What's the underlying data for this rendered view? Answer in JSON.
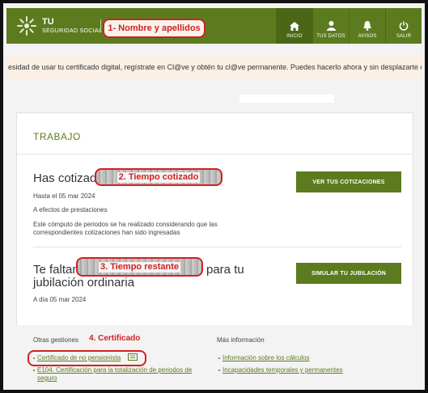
{
  "header": {
    "logo_line1": "TU",
    "logo_line2": "SEGURIDAD SOCIAL",
    "nav": [
      {
        "label": "INICIO",
        "icon": "home-icon"
      },
      {
        "label": "TUS DATOS",
        "icon": "user-icon"
      },
      {
        "label": "AVISOS",
        "icon": "bell-icon"
      },
      {
        "label": "SALIR",
        "icon": "power-icon"
      }
    ]
  },
  "annotations": {
    "name": "1- Nombre y apellidos",
    "time": "2. Tiempo cotizado",
    "remaining": "3. Tiempo restante",
    "certificate": "4. Certificado"
  },
  "banner": {
    "text": "esidad de usar tu certificado digital, regístrate en Cl@ve y obtén tu cl@ve permanente. Puedes hacerlo ahora y sin desplazarte desde aquí"
  },
  "trabajo": {
    "title": "TRABAJO",
    "cotizado_label": "Has cotizado",
    "cotizado_date": "Hasta el 05 mar 2024",
    "cotizado_note": "A efectos de prestaciones",
    "cotizado_desc": "Este cómputo de periodos se ha realizado considerando que las correspondientes cotizaciones han sido ingresadas",
    "cotizaciones_button": "VER TUS COTIZACIONES",
    "faltan_prefix": "Te faltan",
    "faltan_suffix": "para tu",
    "faltan_line2": "jubilación ordinaria",
    "faltan_date": "A día 05 mar 2024",
    "simular_button": "SIMULAR TU JUBILACIÓN"
  },
  "otras": {
    "heading": "Otras gestiones",
    "links": [
      "Certificado de no pensionista",
      "E104. Certificación para la totalización de periodos de seguro"
    ]
  },
  "mas": {
    "heading": "Más información",
    "links": [
      "Información sobre los cálculos",
      "Incapacidades temporales y permanentes"
    ]
  },
  "colors": {
    "brand_green": "#5c7b1e",
    "annotation_red": "#d42020",
    "banner_bg": "#faf0e5"
  }
}
